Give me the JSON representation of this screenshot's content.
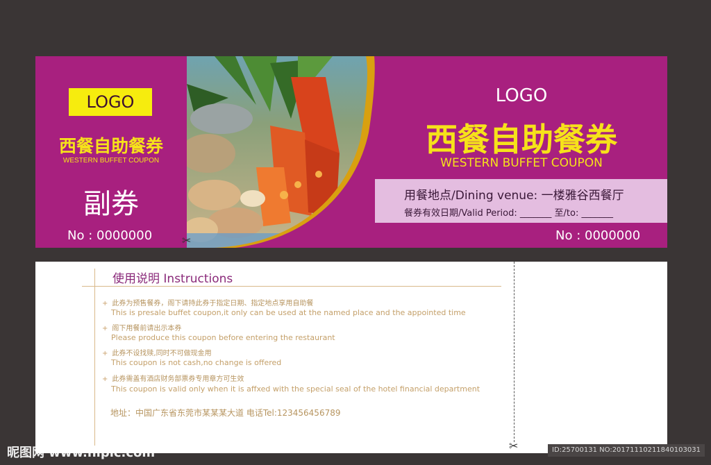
{
  "stub": {
    "logo": "LOGO",
    "title": "西餐自助餐券",
    "subtitle": "WESTERN BUFFET COUPON",
    "label": "副券",
    "number": "No : 0000000"
  },
  "main": {
    "logo": "LOGO",
    "title": "西餐自助餐券",
    "subtitle": "WESTERN BUFFET COUPON",
    "venue": "用餐地点/Dining venue: 一楼雅谷西餐厅",
    "period": "餐券有效日期/Valid Period: _______  至/to: _______",
    "number": "No : 0000000"
  },
  "instructions": {
    "title": "使用说明 Instructions",
    "items": [
      {
        "cn": "此券为预售餐券，阁下请持此券于指定日期、指定地点享用自助餐",
        "en": "This is presale buffet coupon,it only can be used at the named place and the appointed time"
      },
      {
        "cn": "阁下用餐前请出示本券",
        "en": "Please produce this coupon before entering the restaurant"
      },
      {
        "cn": "此券不设找赎,同时不可做现金用",
        "en": "This coupon is not cash,no change is offered"
      },
      {
        "cn": "此券需盖有酒店财务部票券专用章方可生效",
        "en": "This coupon is valid only when it is affxed with the special seal of the hotel financial department"
      }
    ],
    "address": "地址：中国广东省东莞市某某某大道      电话Tel:123456456789"
  },
  "watermark": {
    "left": "昵图网 www.nipic.com",
    "right": "ID:25700131 NO:20171110211840103031"
  },
  "icons": {
    "plus": "+",
    "scissors": "✂"
  },
  "colors": {
    "purple": "#a8207f",
    "yellow": "#f6e21a",
    "venue_box": "#e4bde0",
    "gold": "#d9a010"
  }
}
